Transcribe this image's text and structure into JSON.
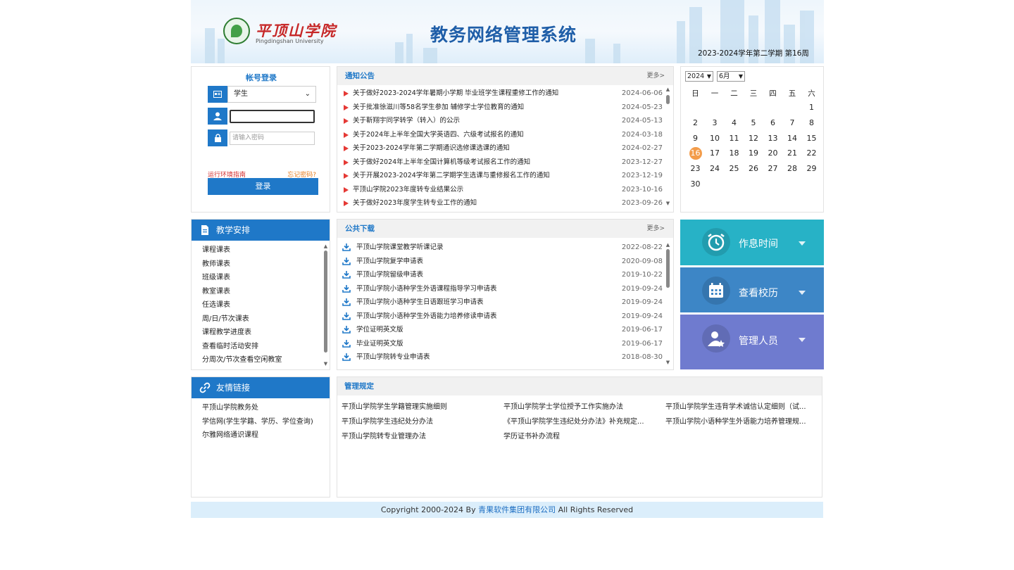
{
  "header": {
    "school_cn": "平顶山学院",
    "school_en": "Pingdingshan University",
    "system_title": "教务网络管理系统",
    "term": "2023-2024学年第二学期  第16周"
  },
  "login": {
    "title": "帐号登录",
    "role_selected": "学生",
    "username_value": "",
    "password_placeholder": "请输入密码",
    "env_guide": "运行环境指南",
    "forgot": "忘记密码?",
    "submit": "登录"
  },
  "notice": {
    "title": "通知公告",
    "more": "更多>",
    "items": [
      {
        "text": "关于做好2023-2024学年暑期小学期 毕业班学生课程重修工作的通知",
        "date": "2024-06-06"
      },
      {
        "text": "关于批准徐滋川等58名学生参加 辅修学士学位教育的通知",
        "date": "2024-05-23"
      },
      {
        "text": "关于靳翔宇同学转学（转入）的公示",
        "date": "2024-05-13"
      },
      {
        "text": "关于2024年上半年全国大学英语四、六级考试报名的通知",
        "date": "2024-03-18"
      },
      {
        "text": "关于2023-2024学年第二学期通识选修课选课的通知",
        "date": "2024-02-27"
      },
      {
        "text": "关于做好2024年上半年全国计算机等级考试报名工作的通知",
        "date": "2023-12-27"
      },
      {
        "text": "关于开展2023-2024学年第二学期学生选课与重修报名工作的通知",
        "date": "2023-12-19"
      },
      {
        "text": "平顶山学院2023年度转专业结果公示",
        "date": "2023-10-16"
      },
      {
        "text": "关于做好2023年度学生转专业工作的通知",
        "date": "2023-09-26"
      }
    ]
  },
  "calendar": {
    "year": "2024",
    "month": "6月",
    "weekdays": [
      "日",
      "一",
      "二",
      "三",
      "四",
      "五",
      "六"
    ],
    "today": "16"
  },
  "teaching": {
    "title": "教学安排",
    "items": [
      "课程课表",
      "教师课表",
      "班级课表",
      "教室课表",
      "任选课表",
      "周/日/节次课表",
      "课程教学进度表",
      "查看临时活动安排",
      "分周次/节次查看空闲教室"
    ]
  },
  "download": {
    "title": "公共下载",
    "more": "更多>",
    "items": [
      {
        "text": "平顶山学院课堂教学听课记录",
        "date": "2022-08-22"
      },
      {
        "text": "平顶山学院复学申请表",
        "date": "2020-09-08"
      },
      {
        "text": "平顶山学院留级申请表",
        "date": "2019-10-22"
      },
      {
        "text": "平顶山学院小语种学生外语课程指导学习申请表",
        "date": "2019-09-24"
      },
      {
        "text": "平顶山学院小语种学生日语跟班学习申请表",
        "date": "2019-09-24"
      },
      {
        "text": "平顶山学院小语种学生外语能力培养修读申请表",
        "date": "2019-09-24"
      },
      {
        "text": "学位证明英文版",
        "date": "2019-06-17"
      },
      {
        "text": "毕业证明英文版",
        "date": "2019-06-17"
      },
      {
        "text": "平顶山学院转专业申请表",
        "date": "2018-08-30"
      }
    ]
  },
  "tiles": [
    {
      "label": "作息时间",
      "icon": "alarm-clock-icon",
      "color": "#27b2c6"
    },
    {
      "label": "查看校历",
      "icon": "calendar-icon",
      "color": "#3d86c6"
    },
    {
      "label": "管理人员",
      "icon": "admin-user-icon",
      "color": "#6f7bcf"
    }
  ],
  "links": {
    "title": "友情链接",
    "items": [
      "平顶山学院教务处",
      "学信网(学生学籍、学历、学位查询)",
      "尔雅网络通识课程"
    ]
  },
  "rules": {
    "title": "管理规定",
    "items": [
      "平顶山学院学生学籍管理实施细则",
      "平顶山学院学士学位授予工作实施办法",
      "平顶山学院学生违背学术诚信认定细则（试...",
      "平顶山学院学生违纪处分办法",
      "《平顶山学院学生违纪处分办法》补充规定...",
      "平顶山学院小语种学生外语能力培养管理规...",
      "平顶山学院转专业管理办法",
      "学历证书补办流程"
    ]
  },
  "footer": {
    "prefix": "Copyright 2000-2024 By ",
    "company": "青果软件集团有限公司",
    "suffix": " All Rights Reserved"
  },
  "colors": {
    "primary": "#1f78c8",
    "today": "#f39c4a",
    "notice_bullet": "#e53935"
  }
}
